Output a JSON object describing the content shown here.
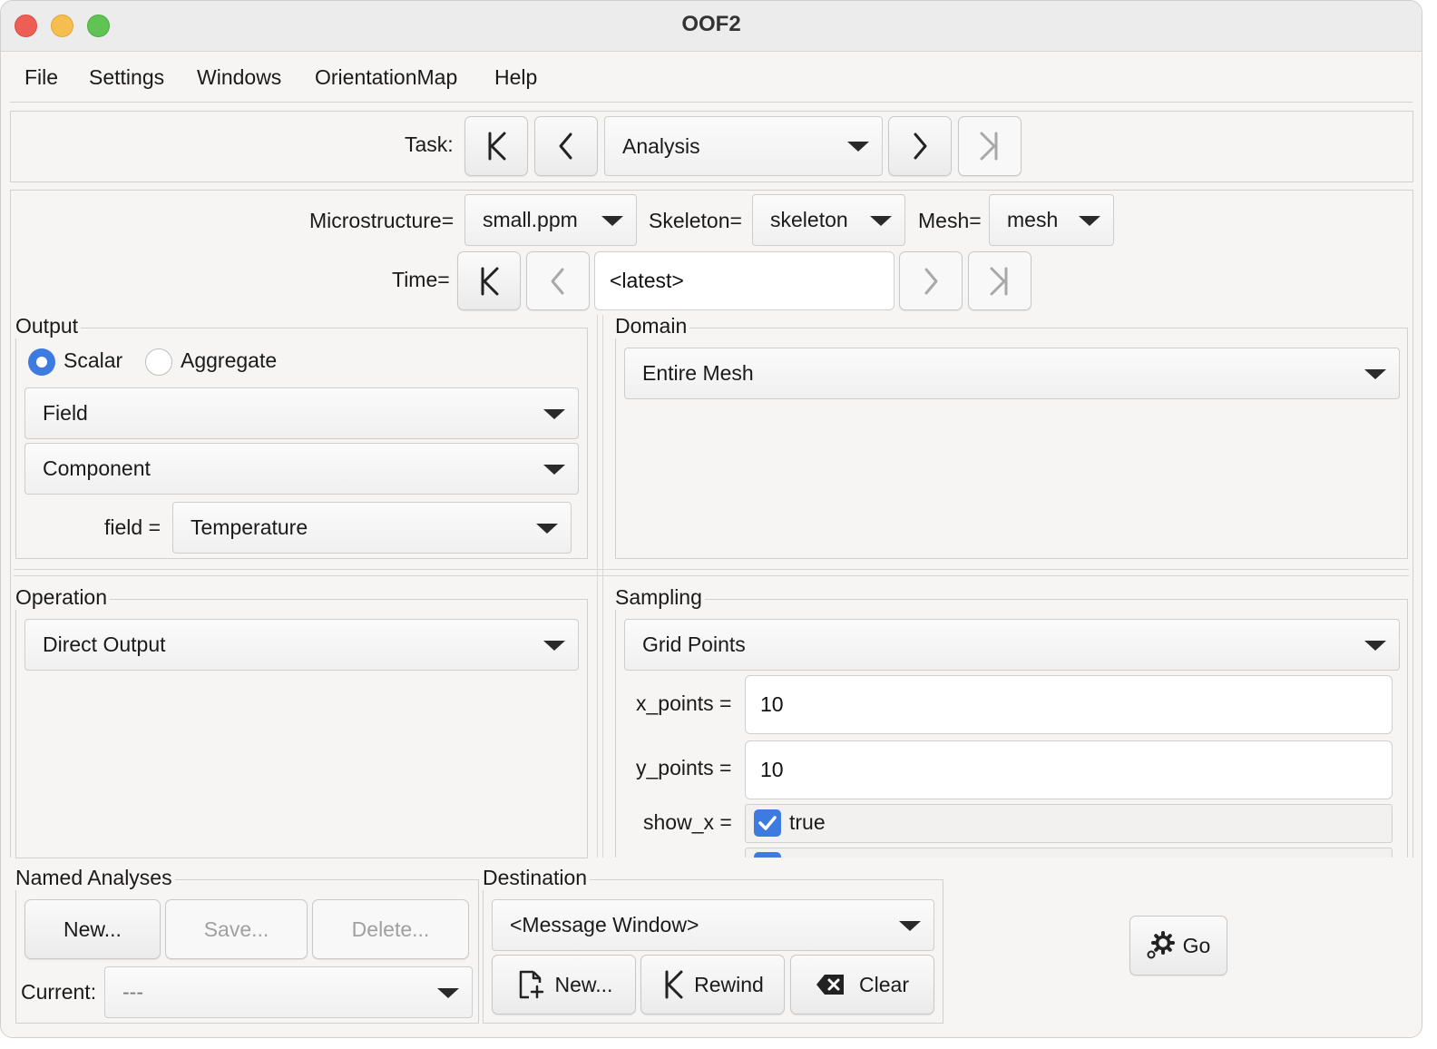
{
  "window": {
    "title": "OOF2"
  },
  "menu": [
    "File",
    "Settings",
    "Windows",
    "OrientationMap",
    "Help"
  ],
  "task": {
    "label": "Task:",
    "value": "Analysis"
  },
  "selectors": {
    "microstructure_label": "Microstructure=",
    "microstructure_value": "small.ppm",
    "skeleton_label": "Skeleton=",
    "skeleton_value": "skeleton",
    "mesh_label": "Mesh=",
    "mesh_value": "mesh",
    "time_label": "Time=",
    "time_value": "<latest>"
  },
  "output": {
    "title": "Output",
    "radio_scalar": "Scalar",
    "radio_aggregate": "Aggregate",
    "selected": "Scalar",
    "field_combo": "Field",
    "component_combo": "Component",
    "field_param_label": "field =",
    "field_param_value": "Temperature"
  },
  "domain": {
    "title": "Domain",
    "value": "Entire Mesh"
  },
  "operation": {
    "title": "Operation",
    "value": "Direct Output"
  },
  "sampling": {
    "title": "Sampling",
    "value": "Grid Points",
    "x_points_label": "x_points =",
    "x_points_value": "10",
    "y_points_label": "y_points =",
    "y_points_value": "10",
    "show_x_label": "show_x =",
    "show_x_value": "true",
    "show_x_checked": true
  },
  "named_analyses": {
    "title": "Named Analyses",
    "new_label": "New...",
    "save_label": "Save...",
    "delete_label": "Delete...",
    "current_label": "Current:",
    "current_value": "---"
  },
  "destination": {
    "title": "Destination",
    "value": "<Message Window>",
    "new_label": "New...",
    "rewind_label": "Rewind",
    "clear_label": "Clear"
  },
  "go": {
    "label": "Go"
  },
  "colors": {
    "close": "#ee5e55",
    "minimize": "#f5be4f",
    "zoom": "#5fc454",
    "accent": "#3d7be0"
  }
}
